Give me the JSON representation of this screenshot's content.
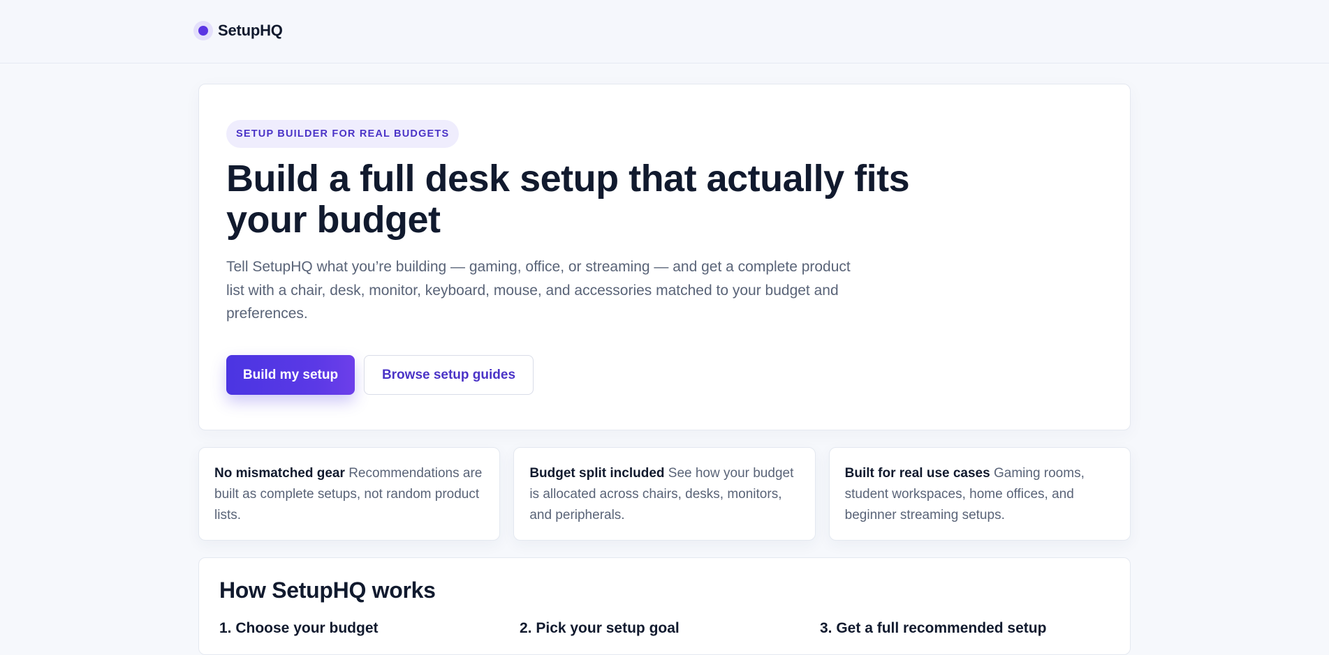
{
  "header": {
    "brand_name": "SetupHQ"
  },
  "hero": {
    "eyebrow": "SETUP BUILDER FOR REAL BUDGETS",
    "title": "Build a full desk setup that actually fits your budget",
    "subtitle": "Tell SetupHQ what you’re building — gaming, office, or streaming — and get a complete product list with a chair, desk, monitor, keyboard, mouse, and accessories matched to your budget and preferences.",
    "primary_cta": "Build my setup",
    "secondary_cta": "Browse setup guides"
  },
  "features": [
    {
      "title": "No mismatched gear",
      "text": "Recommendations are built as complete setups, not random product lists."
    },
    {
      "title": "Budget split included",
      "text": "See how your budget is allocated across chairs, desks, monitors, and peripherals."
    },
    {
      "title": "Built for real use cases",
      "text": "Gaming rooms, student workspaces, home offices, and beginner streaming setups."
    }
  ],
  "how_it_works": {
    "title": "How SetupHQ works",
    "steps": [
      "1. Choose your budget",
      "2. Pick your setup goal",
      "3. Get a full recommended setup"
    ]
  },
  "colors": {
    "accent": "#5b39e6",
    "accent_dark": "#4b34c7",
    "text_primary": "#111a2e",
    "text_muted": "#5a6478",
    "page_bg": "#f6f8fc"
  }
}
